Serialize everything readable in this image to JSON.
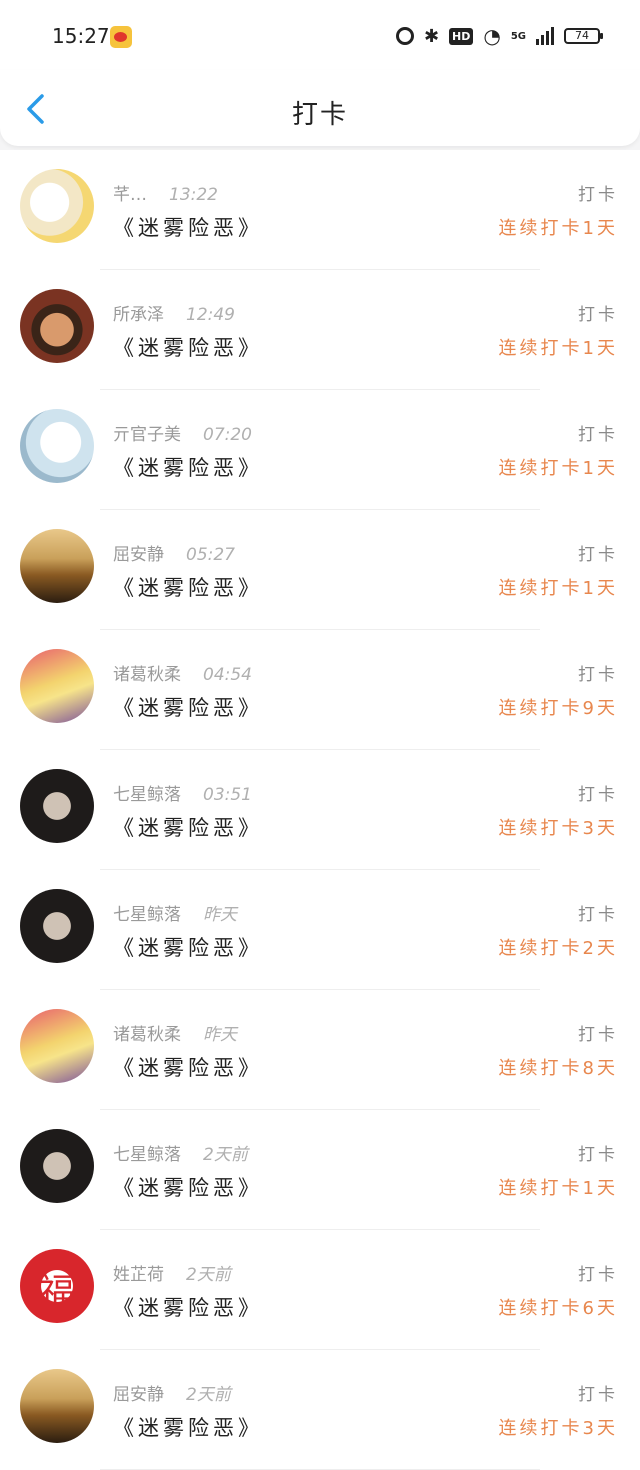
{
  "status": {
    "time": "15:27",
    "battery": "74",
    "network": "5G",
    "hd": "HD"
  },
  "header": {
    "title": "打卡",
    "back_icon": "chevron-left-icon"
  },
  "colors": {
    "accent": "#2a9be8",
    "streak": "#e8874e",
    "muted": "#9a9a9a"
  },
  "entries": [
    {
      "name": "芊…",
      "time": "13:22",
      "book": "《迷雾险恶》",
      "action": "打卡",
      "streak": "连续打卡1天",
      "avatar": "cartoon-girl"
    },
    {
      "name": "所承泽",
      "time": "12:49",
      "book": "《迷雾险恶》",
      "action": "打卡",
      "streak": "连续打卡1天",
      "avatar": "boy-photo"
    },
    {
      "name": "亓官子美",
      "time": "07:20",
      "book": "《迷雾险恶》",
      "action": "打卡",
      "streak": "连续打卡1天",
      "avatar": "anime-white"
    },
    {
      "name": "屈安静",
      "time": "05:27",
      "book": "《迷雾险恶》",
      "action": "打卡",
      "streak": "连续打卡1天",
      "avatar": "tiger"
    },
    {
      "name": "诸葛秋柔",
      "time": "04:54",
      "book": "《迷雾险恶》",
      "action": "打卡",
      "streak": "连续打卡9天",
      "avatar": "flowers-note"
    },
    {
      "name": "七星鲸落",
      "time": "03:51",
      "book": "《迷雾险恶》",
      "action": "打卡",
      "streak": "连续打卡3天",
      "avatar": "dark-portrait"
    },
    {
      "name": "七星鲸落",
      "time": "昨天",
      "book": "《迷雾险恶》",
      "action": "打卡",
      "streak": "连续打卡2天",
      "avatar": "dark-portrait"
    },
    {
      "name": "诸葛秋柔",
      "time": "昨天",
      "book": "《迷雾险恶》",
      "action": "打卡",
      "streak": "连续打卡8天",
      "avatar": "flowers-note"
    },
    {
      "name": "七星鲸落",
      "time": "2天前",
      "book": "《迷雾险恶》",
      "action": "打卡",
      "streak": "连续打卡1天",
      "avatar": "dark-portrait"
    },
    {
      "name": "姓芷荷",
      "time": "2天前",
      "book": "《迷雾险恶》",
      "action": "打卡",
      "streak": "连续打卡6天",
      "avatar": "fu-symbol"
    },
    {
      "name": "屈安静",
      "time": "2天前",
      "book": "《迷雾险恶》",
      "action": "打卡",
      "streak": "连续打卡3天",
      "avatar": "tiger"
    }
  ]
}
